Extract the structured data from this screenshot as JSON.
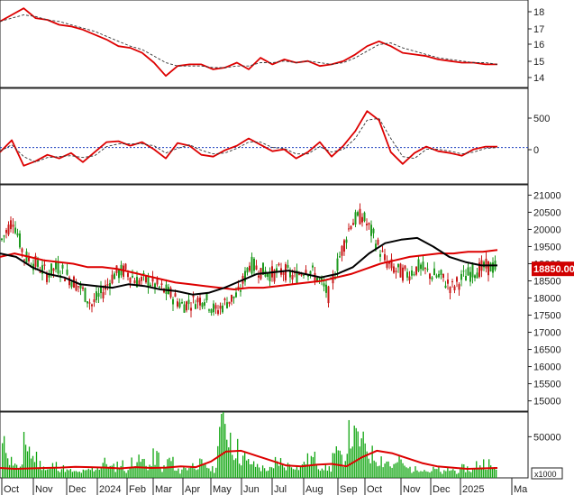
{
  "chart_data": [
    {
      "panel": "trend",
      "type": "line",
      "yticks": [
        "18",
        "17",
        "16",
        "15",
        "14"
      ],
      "ylim": [
        13.5,
        18.8
      ],
      "series": [
        {
          "color": "#dd0000",
          "style": "solid",
          "values": [
            17.5,
            17.9,
            18.3,
            17.7,
            17.6,
            17.3,
            17.2,
            17.0,
            16.7,
            16.4,
            16.0,
            15.9,
            15.6,
            15.0,
            14.2,
            14.8,
            14.9,
            14.9,
            14.6,
            14.7,
            15.0,
            14.6,
            15.3,
            14.9,
            15.2,
            15.0,
            15.1,
            14.8,
            14.9,
            15.1,
            15.5,
            16.0,
            16.3,
            16.0,
            15.6,
            15.5,
            15.4,
            15.2,
            15.1,
            15.0,
            15.0,
            14.9,
            14.9
          ]
        },
        {
          "color": "#333333",
          "style": "dashed",
          "values": [
            17.5,
            17.7,
            17.9,
            17.8,
            17.6,
            17.5,
            17.3,
            17.1,
            16.9,
            16.6,
            16.3,
            16.0,
            15.8,
            15.4,
            15.0,
            14.8,
            14.8,
            14.8,
            14.7,
            14.7,
            14.8,
            14.8,
            15.0,
            15.0,
            15.1,
            15.0,
            15.1,
            15.0,
            14.9,
            15.0,
            15.3,
            15.7,
            16.1,
            16.2,
            15.9,
            15.7,
            15.5,
            15.3,
            15.2,
            15.1,
            15.0,
            15.0,
            14.9
          ]
        }
      ]
    },
    {
      "panel": "oscillator",
      "type": "line",
      "yticks": [
        "500",
        "0"
      ],
      "ylim": [
        -400,
        650
      ],
      "zero_line": true,
      "series": [
        {
          "color": "#dd0000",
          "style": "solid",
          "values": [
            -50,
            80,
            -200,
            -150,
            -80,
            -120,
            -60,
            -160,
            -50,
            60,
            70,
            20,
            60,
            -20,
            -120,
            50,
            20,
            -80,
            -100,
            -30,
            20,
            100,
            30,
            -40,
            -20,
            -120,
            -50,
            60,
            -100,
            20,
            180,
            400,
            300,
            -50,
            -180,
            -60,
            10,
            -40,
            -60,
            -90,
            -20,
            10,
            10
          ]
        },
        {
          "color": "#333333",
          "style": "dashed",
          "values": [
            -40,
            30,
            -100,
            -160,
            -110,
            -100,
            -90,
            -110,
            -90,
            10,
            40,
            40,
            40,
            20,
            -60,
            -10,
            30,
            -30,
            -70,
            -60,
            -10,
            60,
            60,
            0,
            -10,
            -70,
            -70,
            10,
            -50,
            -20,
            100,
            300,
            320,
            100,
            -100,
            -120,
            -20,
            -20,
            -40,
            -70,
            -50,
            -10,
            0
          ]
        }
      ]
    },
    {
      "panel": "price",
      "type": "line",
      "price_label": "18850.00",
      "yticks": [
        "21000",
        "20500",
        "20000",
        "19500",
        "19000",
        "18500",
        "18000",
        "17500",
        "17000",
        "16500",
        "16000",
        "15500",
        "15000"
      ],
      "ylim": [
        14700,
        21300
      ],
      "price": [
        19700,
        20300,
        19200,
        19000,
        18700,
        18900,
        18600,
        18300,
        17800,
        18200,
        18700,
        18800,
        18500,
        18500,
        18300,
        18100,
        17800,
        17900,
        18000,
        17600,
        17900,
        18100,
        19000,
        18800,
        18700,
        18800,
        18600,
        18900,
        18600,
        18100,
        19200,
        20200,
        20400,
        19800,
        19100,
        18800,
        18700,
        18900,
        18700,
        18600,
        18300,
        18600,
        18800,
        18900,
        18900
      ],
      "series": [
        {
          "color": "#dd0000",
          "values": [
            19200,
            19300,
            19200,
            19100,
            19050,
            19000,
            18900,
            18900,
            18850,
            18750,
            18650,
            18550,
            18450,
            18400,
            18350,
            18300,
            18250,
            18300,
            18300,
            18350,
            18400,
            18450,
            18500,
            18600,
            18700,
            18850,
            19000,
            19100,
            19200,
            19250,
            19300,
            19300,
            19350,
            19350,
            19400
          ]
        },
        {
          "color": "#000000",
          "values": [
            19300,
            19200,
            18900,
            18700,
            18600,
            18400,
            18350,
            18300,
            18400,
            18350,
            18250,
            18200,
            18100,
            18150,
            18300,
            18500,
            18700,
            18750,
            18800,
            18700,
            18600,
            18700,
            18900,
            19300,
            19600,
            19700,
            19750,
            19500,
            19200,
            19050,
            18950,
            18950
          ]
        }
      ]
    },
    {
      "panel": "volume",
      "type": "bar",
      "unit_label": "x1000",
      "yticks": [
        "50000"
      ],
      "ylim": [
        0,
        80000
      ],
      "ma": {
        "color": "#dd0000",
        "values": [
          12000,
          11000,
          11500,
          12000,
          12500,
          13500,
          13000,
          12500,
          11500,
          13000,
          12000,
          12500,
          14000,
          13000,
          20000,
          32000,
          33000,
          27000,
          21000,
          15000,
          14000,
          16000,
          17000,
          14000,
          25000,
          33000,
          30000,
          24000,
          18000,
          14000,
          12500,
          11000,
          11500,
          12000
        ]
      },
      "values": [
        45000,
        25000,
        15000,
        48000,
        30000,
        20000,
        12000,
        18000,
        14000,
        10000,
        8000,
        9000,
        12000,
        16000,
        22000,
        15000,
        20000,
        12000,
        28000,
        24000,
        18000,
        30000,
        14000,
        26000,
        10000,
        14000,
        18000,
        20000,
        16000,
        12000,
        84000,
        66000,
        42000,
        30000,
        22000,
        18000,
        14000,
        12000,
        24000,
        18000,
        20000,
        16000,
        26000,
        28000,
        18000,
        14000,
        34000,
        28000,
        60000,
        56000,
        48000,
        34000,
        28000,
        24000,
        18000,
        24000,
        14000,
        12000,
        16000,
        10000,
        12000,
        8000,
        12000,
        10000,
        14000,
        12000,
        20000,
        22000,
        14000
      ]
    }
  ],
  "x_axis": {
    "months": [
      "Oct",
      "Nov",
      "Dec",
      "2024",
      "Feb",
      "Mar",
      "Apr",
      "May",
      "Jun",
      "Jul",
      "Aug",
      "Sep",
      "Oct",
      "Nov",
      "Dec",
      "2025",
      "Ma"
    ]
  }
}
